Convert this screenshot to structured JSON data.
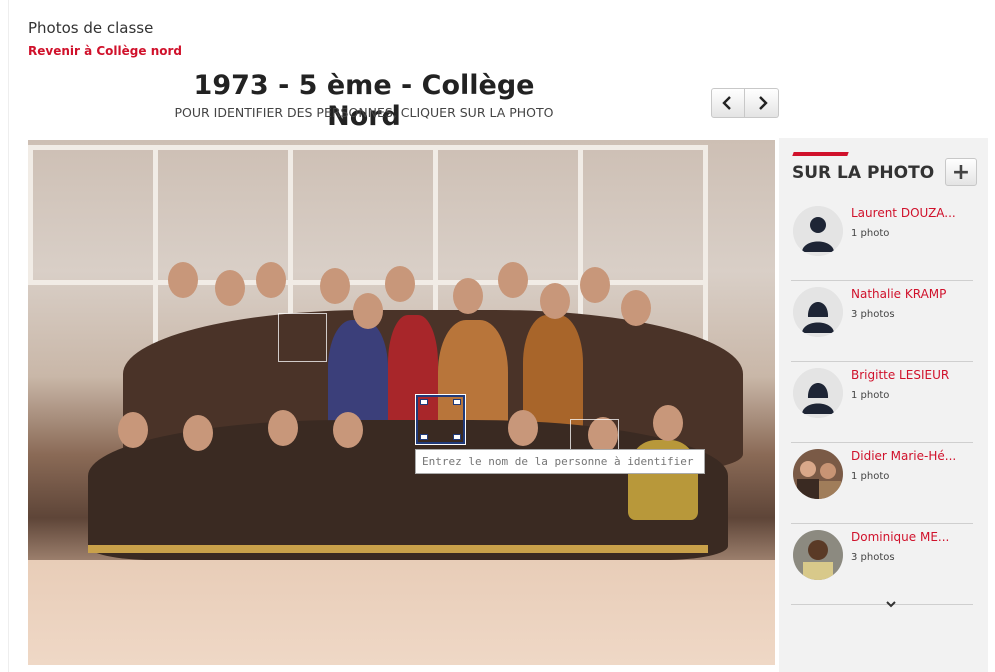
{
  "header": {
    "section_title": "Photos de classe",
    "back_link": "Revenir à Collège nord"
  },
  "photo": {
    "title": "1973 - 5 ème - Collège Nord",
    "subtitle": "POUR IDENTIFIER DES PERSONNES, CLIQUER SUR LA PHOTO",
    "tag_input_placeholder": "Entrez le nom de la personne à identifier"
  },
  "nav": {
    "prev_icon": "chevron-left-icon",
    "next_icon": "chevron-right-icon"
  },
  "sidebar": {
    "heading": "SUR LA PHOTO",
    "add_icon": "plus-icon",
    "people": [
      {
        "name": "Laurent DOUZA...",
        "count": "1 photo",
        "avatar": "male-silhouette"
      },
      {
        "name": "Nathalie KRAMP",
        "count": "3 photos",
        "avatar": "female-silhouette"
      },
      {
        "name": "Brigitte LESIEUR",
        "count": "1 photo",
        "avatar": "female-silhouette"
      },
      {
        "name": "Didier Marie-Hé...",
        "count": "1 photo",
        "avatar": "photo"
      },
      {
        "name": "Dominique ME...",
        "count": "3 photos",
        "avatar": "photo"
      }
    ],
    "more_icon": "chevron-down-icon"
  },
  "colors": {
    "accent": "#d0112b",
    "tag_border": "#203a7a"
  }
}
